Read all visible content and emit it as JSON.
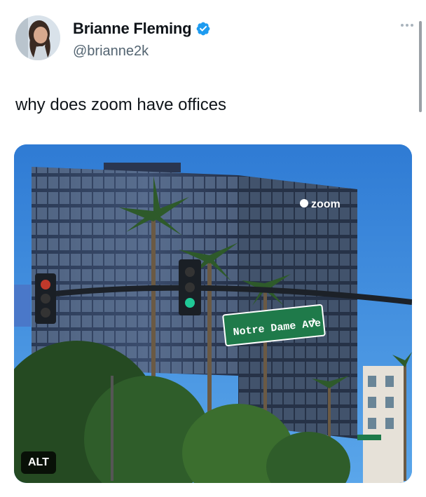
{
  "author": {
    "name": "Brianne Fleming",
    "handle": "@brianne2k",
    "verified": true,
    "avatar_icon": "avatar-photo"
  },
  "tweet": {
    "text": "why does zoom have offices"
  },
  "media": {
    "alt_label": "ALT",
    "building_sign": "zoom",
    "street_sign": "Notre Dame Ave",
    "street_sign_arrow": "➔"
  },
  "colors": {
    "verified_blue": "#1d9bf0",
    "sky": "#3a8de0",
    "street_sign_green": "#1f7a4a",
    "text_primary": "#0f1419",
    "text_secondary": "#536471"
  },
  "icons": {
    "more": "more-horizontal-icon",
    "verified": "verified-badge-icon"
  }
}
